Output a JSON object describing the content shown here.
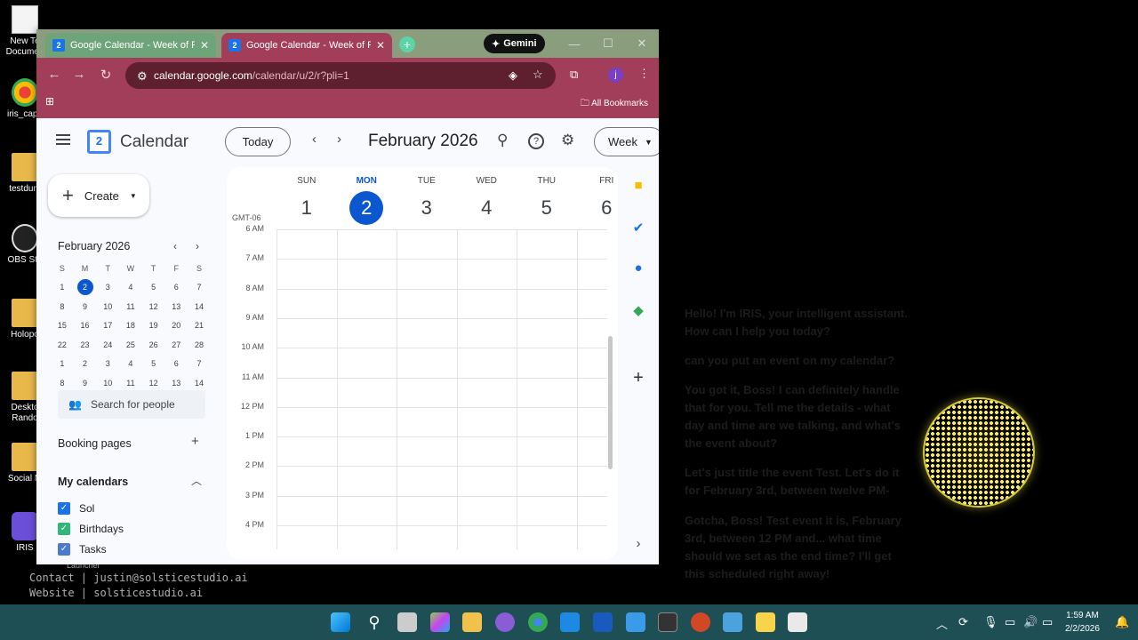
{
  "desktop": {
    "icons": [
      "New Te\nDocumen",
      "iris_capa",
      "testdum",
      "OBS Stu",
      "Holopo",
      "Deskto\nRando",
      "Social M",
      "IRIS"
    ],
    "launcher_label": "Launcher",
    "footer_contact": "Contact | justin@solsticestudio.ai",
    "footer_website": "Website | solsticestudio.ai"
  },
  "browser": {
    "tabs": [
      {
        "title": "Google Calendar - Week of Feb"
      },
      {
        "title": "Google Calendar - Week of Feb"
      }
    ],
    "gemini_label": "Gemini",
    "url_host": "calendar.google.com",
    "url_path": "/calendar/u/2/r?pli=1",
    "bookmarks_label": "All Bookmarks",
    "avatar_letter": "j"
  },
  "calendar": {
    "app_name": "Calendar",
    "logo_num": "2",
    "today_label": "Today",
    "month_title": "February 2026",
    "view_label": "Week",
    "create_label": "Create",
    "mini": {
      "title": "February 2026",
      "dow": [
        "S",
        "M",
        "T",
        "W",
        "T",
        "F",
        "S"
      ],
      "weeks": [
        [
          "1",
          "2",
          "3",
          "4",
          "5",
          "6",
          "7"
        ],
        [
          "8",
          "9",
          "10",
          "11",
          "12",
          "13",
          "14"
        ],
        [
          "15",
          "16",
          "17",
          "18",
          "19",
          "20",
          "21"
        ],
        [
          "22",
          "23",
          "24",
          "25",
          "26",
          "27",
          "28"
        ],
        [
          "1",
          "2",
          "3",
          "4",
          "5",
          "6",
          "7"
        ],
        [
          "8",
          "9",
          "10",
          "11",
          "12",
          "13",
          "14"
        ]
      ],
      "selected": "2"
    },
    "search_people": "Search for people",
    "booking_pages": "Booking pages",
    "my_calendars": "My calendars",
    "calendars": [
      {
        "name": "Sol",
        "color": "#1a73e8"
      },
      {
        "name": "Birthdays",
        "color": "#33b679"
      },
      {
        "name": "Tasks",
        "color": "#4a7bd0"
      }
    ],
    "timezone": "GMT-06",
    "days": [
      {
        "dow": "SUN",
        "date": "1"
      },
      {
        "dow": "MON",
        "date": "2"
      },
      {
        "dow": "TUE",
        "date": "3"
      },
      {
        "dow": "WED",
        "date": "4"
      },
      {
        "dow": "THU",
        "date": "5"
      },
      {
        "dow": "FRI",
        "date": "6"
      }
    ],
    "hours": [
      "6 AM",
      "7 AM",
      "8 AM",
      "9 AM",
      "10 AM",
      "11 AM",
      "12 PM",
      "1 PM",
      "2 PM",
      "3 PM",
      "4 PM"
    ]
  },
  "assistant": {
    "messages": [
      "Hello! I'm IRIS, your intelligent assistant. How can I help you today?",
      " can you put an event on my calendar?",
      "You got it, Boss! I can definitely handle that for you. Tell me the details - what day and time are we talking, and what's the event about?",
      "Let's just title the event Test. Let's do it for February 3rd, between twelve PM-",
      "Gotcha, Boss! Test event it is, February 3rd, between 12 PM and... what time should we set as the end time? I'll get this scheduled right away!"
    ]
  },
  "taskbar": {
    "time": "1:59 AM",
    "date": "2/2/2026"
  }
}
